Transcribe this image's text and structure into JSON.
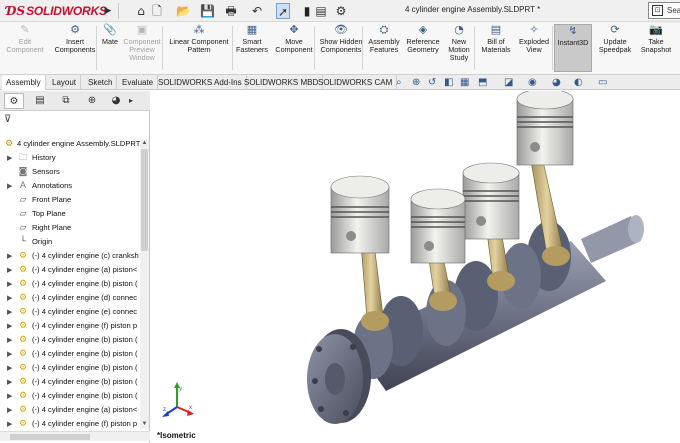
{
  "app": {
    "name": "SOLIDWORKS",
    "document_title": "4 cylinder engine Assembly.SLDPRT *",
    "search_placeholder": "Sea"
  },
  "quick_access": [
    {
      "name": "home-icon",
      "glyph": "⌂"
    },
    {
      "name": "new-icon",
      "glyph": "🗋"
    },
    {
      "name": "open-icon",
      "glyph": "📂"
    },
    {
      "name": "save-icon",
      "glyph": "💾"
    },
    {
      "name": "print-icon",
      "glyph": "🖶"
    },
    {
      "name": "undo-icon",
      "glyph": "↶"
    },
    {
      "name": "select-icon",
      "glyph": "➚"
    },
    {
      "name": "traffic-light-icon",
      "glyph": "▮"
    },
    {
      "name": "file-properties-icon",
      "glyph": "▤"
    },
    {
      "name": "options-gear-icon",
      "glyph": "⚙"
    }
  ],
  "ribbon": [
    {
      "label": "Edit Component",
      "name": "edit-component-button",
      "disabled": true,
      "glyph": "✎"
    },
    {
      "label": "Insert Components",
      "name": "insert-components-button",
      "disabled": false,
      "glyph": "⚙"
    },
    {
      "label": "Mate",
      "name": "mate-button",
      "disabled": false,
      "glyph": "📎"
    },
    {
      "label": "Component Preview Window",
      "name": "component-preview-button",
      "disabled": true,
      "glyph": "▣"
    },
    {
      "label": "Linear Component Pattern",
      "name": "linear-pattern-button",
      "disabled": false,
      "glyph": "⁂"
    },
    {
      "label": "Smart Fasteners",
      "name": "smart-fasteners-button",
      "disabled": false,
      "glyph": "▦"
    },
    {
      "label": "Move Component",
      "name": "move-component-button",
      "disabled": false,
      "glyph": "✥"
    },
    {
      "label": "Show Hidden Components",
      "name": "show-hidden-button",
      "disabled": false,
      "glyph": "👁"
    },
    {
      "label": "Assembly Features",
      "name": "assembly-features-button",
      "disabled": false,
      "glyph": "⛭"
    },
    {
      "label": "Reference Geometry",
      "name": "reference-geometry-button",
      "disabled": false,
      "glyph": "◈"
    },
    {
      "label": "New Motion Study",
      "name": "new-motion-study-button",
      "disabled": false,
      "glyph": "◔"
    },
    {
      "label": "Bill of Materials",
      "name": "bill-of-materials-button",
      "disabled": false,
      "glyph": "▤"
    },
    {
      "label": "Exploded View",
      "name": "exploded-view-button",
      "disabled": false,
      "glyph": "✧"
    },
    {
      "label": "Instant3D",
      "name": "instant3d-button",
      "disabled": false,
      "glyph": "↯",
      "active": true
    },
    {
      "label": "Update Speedpak",
      "name": "update-speedpak-button",
      "disabled": false,
      "glyph": "⟳"
    },
    {
      "label": "Take Snapshot",
      "name": "take-snapshot-button",
      "disabled": false,
      "glyph": "📷"
    }
  ],
  "tabs": [
    {
      "label": "Assembly",
      "active": true
    },
    {
      "label": "Layout"
    },
    {
      "label": "Sketch"
    },
    {
      "label": "Evaluate"
    },
    {
      "label": "SOLIDWORKS Add-Ins"
    },
    {
      "label": "SOLIDWORKS MBD"
    },
    {
      "label": "SOLIDWORKS CAM"
    }
  ],
  "tree": {
    "root": "4 cylinder engine Assembly.SLDPRT",
    "items": [
      {
        "label": "History",
        "icon": "history-icon",
        "expand": "▶"
      },
      {
        "label": "Sensors",
        "icon": "sensors-icon",
        "expand": ""
      },
      {
        "label": "Annotations",
        "icon": "annotations-icon",
        "expand": "▶"
      },
      {
        "label": "Front Plane",
        "icon": "plane-icon",
        "expand": ""
      },
      {
        "label": "Top Plane",
        "icon": "plane-icon",
        "expand": ""
      },
      {
        "label": "Right Plane",
        "icon": "plane-icon",
        "expand": ""
      },
      {
        "label": "Origin",
        "icon": "origin-icon",
        "expand": ""
      },
      {
        "label": "(-) 4 cylinder engine (c) cranksh",
        "icon": "part-icon",
        "expand": "▶"
      },
      {
        "label": "(-) 4 cylinder engine (a) piston<",
        "icon": "part-icon",
        "expand": "▶"
      },
      {
        "label": "(-) 4 cylinder engine (b) piston (",
        "icon": "part-icon",
        "expand": "▶"
      },
      {
        "label": "(-) 4 cylinder engine (d) connec",
        "icon": "part-icon",
        "expand": "▶"
      },
      {
        "label": "(-) 4 cylinder engine (e) connec",
        "icon": "part-icon",
        "expand": "▶"
      },
      {
        "label": "(-) 4 cylinder engine (f) piston p",
        "icon": "part-icon",
        "expand": "▶"
      },
      {
        "label": "(-) 4 cylinder engine (b) piston (",
        "icon": "part-icon",
        "expand": "▶"
      },
      {
        "label": "(-) 4 cylinder engine (b) piston (",
        "icon": "part-icon",
        "expand": "▶"
      },
      {
        "label": "(-) 4 cylinder engine (b) piston (",
        "icon": "part-icon",
        "expand": "▶"
      },
      {
        "label": "(-) 4 cylinder engine (b) piston (",
        "icon": "part-icon",
        "expand": "▶"
      },
      {
        "label": "(-) 4 cylinder engine (b) piston (",
        "icon": "part-icon",
        "expand": "▶"
      },
      {
        "label": "(-) 4 cylinder engine (a) piston<",
        "icon": "part-icon",
        "expand": "▶"
      },
      {
        "label": "(-) 4 cylinder engine (f) piston p",
        "icon": "part-icon",
        "expand": "▶"
      }
    ]
  },
  "viewport": {
    "view_label": "*Isometric",
    "triad": {
      "x": "x",
      "y": "y",
      "z": "z"
    }
  }
}
